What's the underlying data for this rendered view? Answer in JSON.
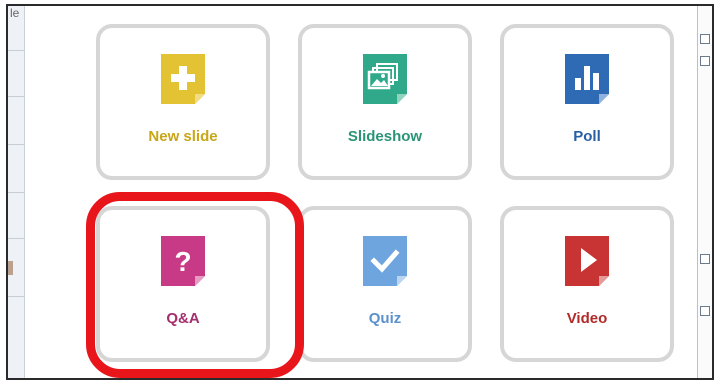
{
  "tiles": [
    {
      "id": "new-slide",
      "label": "New slide",
      "color": "#e3c234",
      "label_color": "#c9a616",
      "icon": "plus-icon"
    },
    {
      "id": "slideshow",
      "label": "Slideshow",
      "color": "#2fa98a",
      "label_color": "#2a9477",
      "icon": "images-icon"
    },
    {
      "id": "poll",
      "label": "Poll",
      "color": "#2f6bb5",
      "label_color": "#2a5ea3",
      "icon": "bar-chart-icon"
    },
    {
      "id": "qa",
      "label": "Q&A",
      "color": "#c83a86",
      "label_color": "#a32f6e",
      "icon": "question-mark-icon"
    },
    {
      "id": "quiz",
      "label": "Quiz",
      "color": "#6fa5de",
      "label_color": "#5b91cc",
      "icon": "checkmark-icon"
    },
    {
      "id": "video",
      "label": "Video",
      "color": "#c83434",
      "label_color": "#b02a2a",
      "icon": "play-icon"
    }
  ],
  "strip_text": "le",
  "highlight_color": "#e8161b"
}
